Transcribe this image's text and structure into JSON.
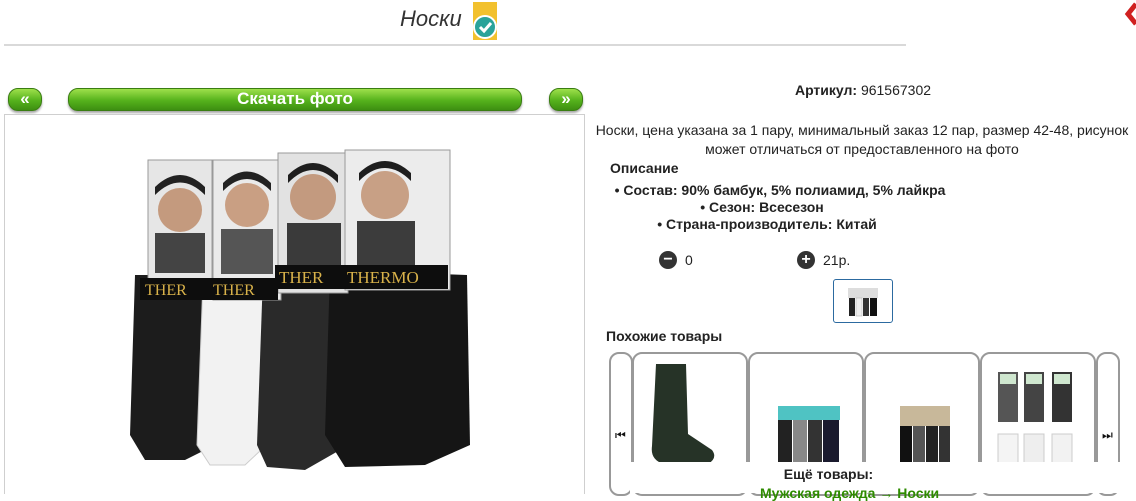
{
  "page": {
    "title": "Носки"
  },
  "gallery": {
    "prev_label": "«",
    "next_label": "»",
    "download_label": "Скачать фото"
  },
  "product": {
    "sku_label": "Артикул:",
    "sku_value": "961567302",
    "description": "Носки, цена указана за 1 пару, минимальный заказ 12 пар, размер 42-48, рисунок может отличаться от предоставленного на фото",
    "description_heading": "Описание",
    "specs": [
      "• Состав: 90% бамбук, 5% полиамид, 5% лайкра",
      "• Сезон: Всесезон",
      "• Страна-производитель: Китай"
    ],
    "quantity": "0",
    "price": "21р."
  },
  "similar": {
    "heading": "Похожие товары",
    "icons": {
      "prev": "skip-back-icon",
      "next": "skip-forward-icon"
    }
  },
  "more": {
    "heading": "Ещё товары:",
    "link": "Мужская одежда → Носки"
  },
  "colors": {
    "accent_green": "#55b21c",
    "link_green": "#2e8b00",
    "verified_badge": "#f2c12e"
  }
}
